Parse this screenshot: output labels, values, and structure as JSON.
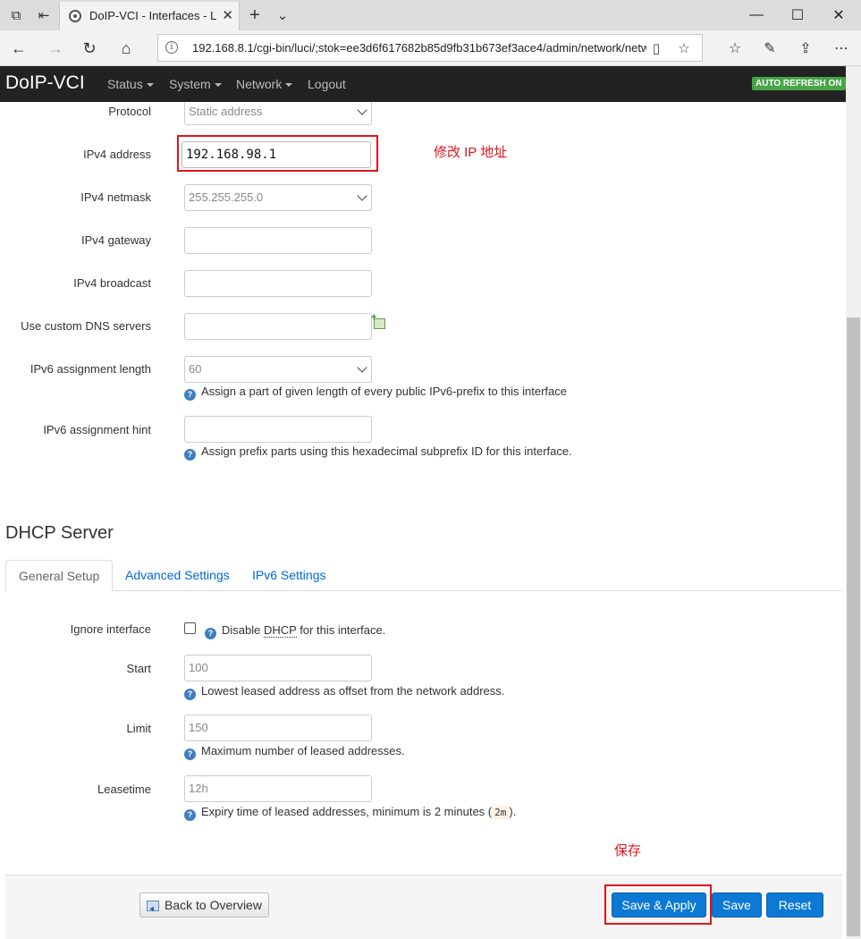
{
  "browser": {
    "tab_title": "DoIP-VCI - Interfaces - L",
    "url": "192.168.8.1/cgi-bin/luci/;stok=ee3d6f617682b85d9fb31b673ef3ace4/admin/network/netw"
  },
  "header": {
    "brand": "DoIP-VCI",
    "menu": [
      "Status",
      "System",
      "Network",
      "Logout"
    ],
    "auto_refresh": "AUTO REFRESH ON"
  },
  "fields": {
    "protocol": {
      "label": "Protocol",
      "value": "Static address"
    },
    "ipv4_address": {
      "label": "IPv4 address",
      "value": "192.168.98.1"
    },
    "ipv4_netmask": {
      "label": "IPv4 netmask",
      "value": "255.255.255.0"
    },
    "ipv4_gateway": {
      "label": "IPv4 gateway",
      "value": ""
    },
    "ipv4_broadcast": {
      "label": "IPv4 broadcast",
      "value": ""
    },
    "dns": {
      "label": "Use custom DNS servers",
      "value": ""
    },
    "ipv6_len": {
      "label": "IPv6 assignment length",
      "value": "60",
      "help": "Assign a part of given length of every public IPv6-prefix to this interface"
    },
    "ipv6_hint": {
      "label": "IPv6 assignment hint",
      "value": "",
      "help": "Assign prefix parts using this hexadecimal subprefix ID for this interface."
    }
  },
  "annotations": {
    "modify_ip": "修改 IP 地址",
    "save": "保存"
  },
  "dhcp": {
    "title": "DHCP Server",
    "tabs": [
      "General Setup",
      "Advanced Settings",
      "IPv6 Settings"
    ],
    "ignore": {
      "label": "Ignore interface",
      "help_pre": "Disable ",
      "help_abbr": "DHCP",
      "help_post": " for this interface."
    },
    "start": {
      "label": "Start",
      "placeholder": "100",
      "help": "Lowest leased address as offset from the network address."
    },
    "limit": {
      "label": "Limit",
      "placeholder": "150",
      "help": "Maximum number of leased addresses."
    },
    "leasetime": {
      "label": "Leasetime",
      "placeholder": "12h",
      "help_pre": "Expiry time of leased addresses, minimum is 2 minutes (",
      "help_code": "2m",
      "help_post": ")."
    }
  },
  "footer": {
    "back": "Back to Overview",
    "save_apply": "Save & Apply",
    "save": "Save",
    "reset": "Reset"
  }
}
